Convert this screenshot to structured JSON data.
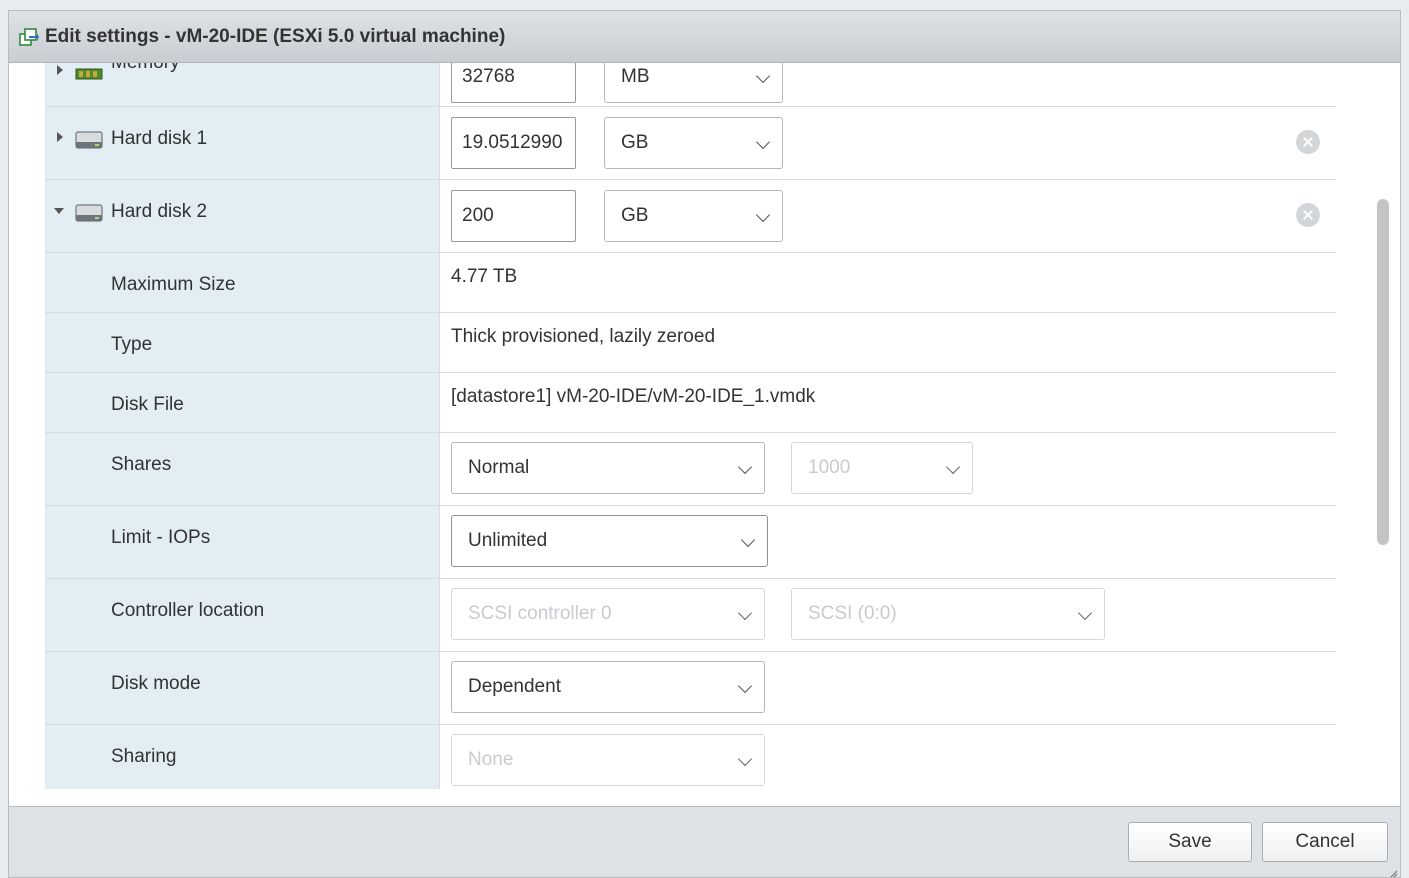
{
  "dialog": {
    "title": "Edit settings - vM-20-IDE (ESXi 5.0 virtual machine)",
    "icon": "vm-settings-icon"
  },
  "memory": {
    "label": "Memory",
    "value": "32768",
    "unit": "MB"
  },
  "hard_disk_1": {
    "label": "Hard disk 1",
    "size": "19.0512990",
    "unit": "GB"
  },
  "hard_disk_2": {
    "label": "Hard disk 2",
    "size": "200",
    "unit": "GB",
    "details": {
      "max_size": {
        "label": "Maximum Size",
        "value": "4.77 TB"
      },
      "type": {
        "label": "Type",
        "value": "Thick provisioned, lazily zeroed"
      },
      "disk_file": {
        "label": "Disk File",
        "value": "[datastore1] vM-20-IDE/vM-20-IDE_1.vmdk"
      },
      "shares": {
        "label": "Shares",
        "level": "Normal",
        "value": "1000"
      },
      "limit_iops": {
        "label": "Limit - IOPs",
        "value": "Unlimited"
      },
      "controller_location": {
        "label": "Controller location",
        "controller": "SCSI controller 0",
        "slot": "SCSI (0:0)"
      },
      "disk_mode": {
        "label": "Disk mode",
        "value": "Dependent"
      },
      "sharing": {
        "label": "Sharing",
        "value": "None"
      }
    }
  },
  "footer": {
    "save_label": "Save",
    "cancel_label": "Cancel"
  }
}
